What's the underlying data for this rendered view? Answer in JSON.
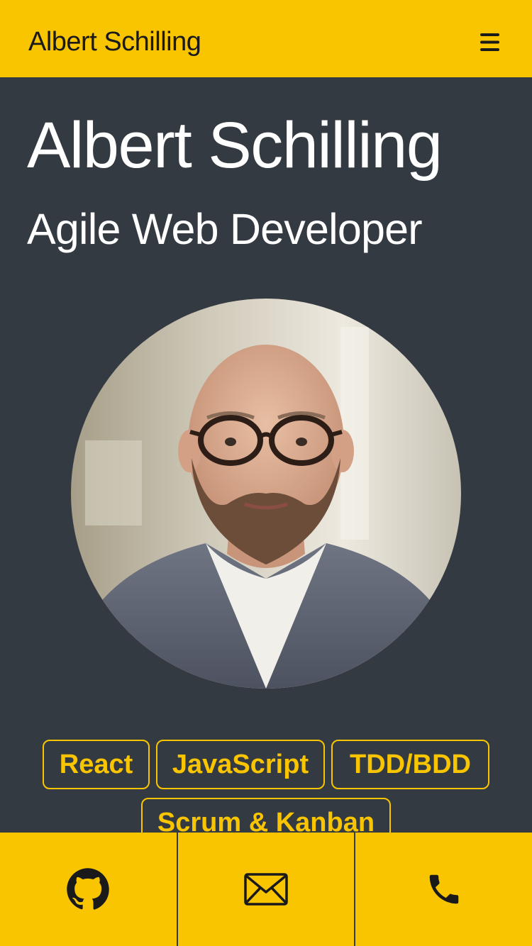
{
  "header": {
    "brand": "Albert Schilling",
    "menu_icon": "hamburger-menu-icon"
  },
  "hero": {
    "name": "Albert Schilling",
    "title": "Agile Web Developer"
  },
  "avatar": {
    "alt": "Portrait of Albert Schilling"
  },
  "skills": [
    {
      "label": "React"
    },
    {
      "label": "JavaScript"
    },
    {
      "label": "TDD/BDD"
    },
    {
      "label": "Scrum & Kanban"
    }
  ],
  "contact": [
    {
      "icon": "github-icon"
    },
    {
      "icon": "mail-icon"
    },
    {
      "icon": "phone-icon"
    }
  ],
  "colors": {
    "accent": "#f9c400",
    "background": "#343a42",
    "text_light": "#ffffff",
    "text_dark": "#1a1a1a"
  }
}
